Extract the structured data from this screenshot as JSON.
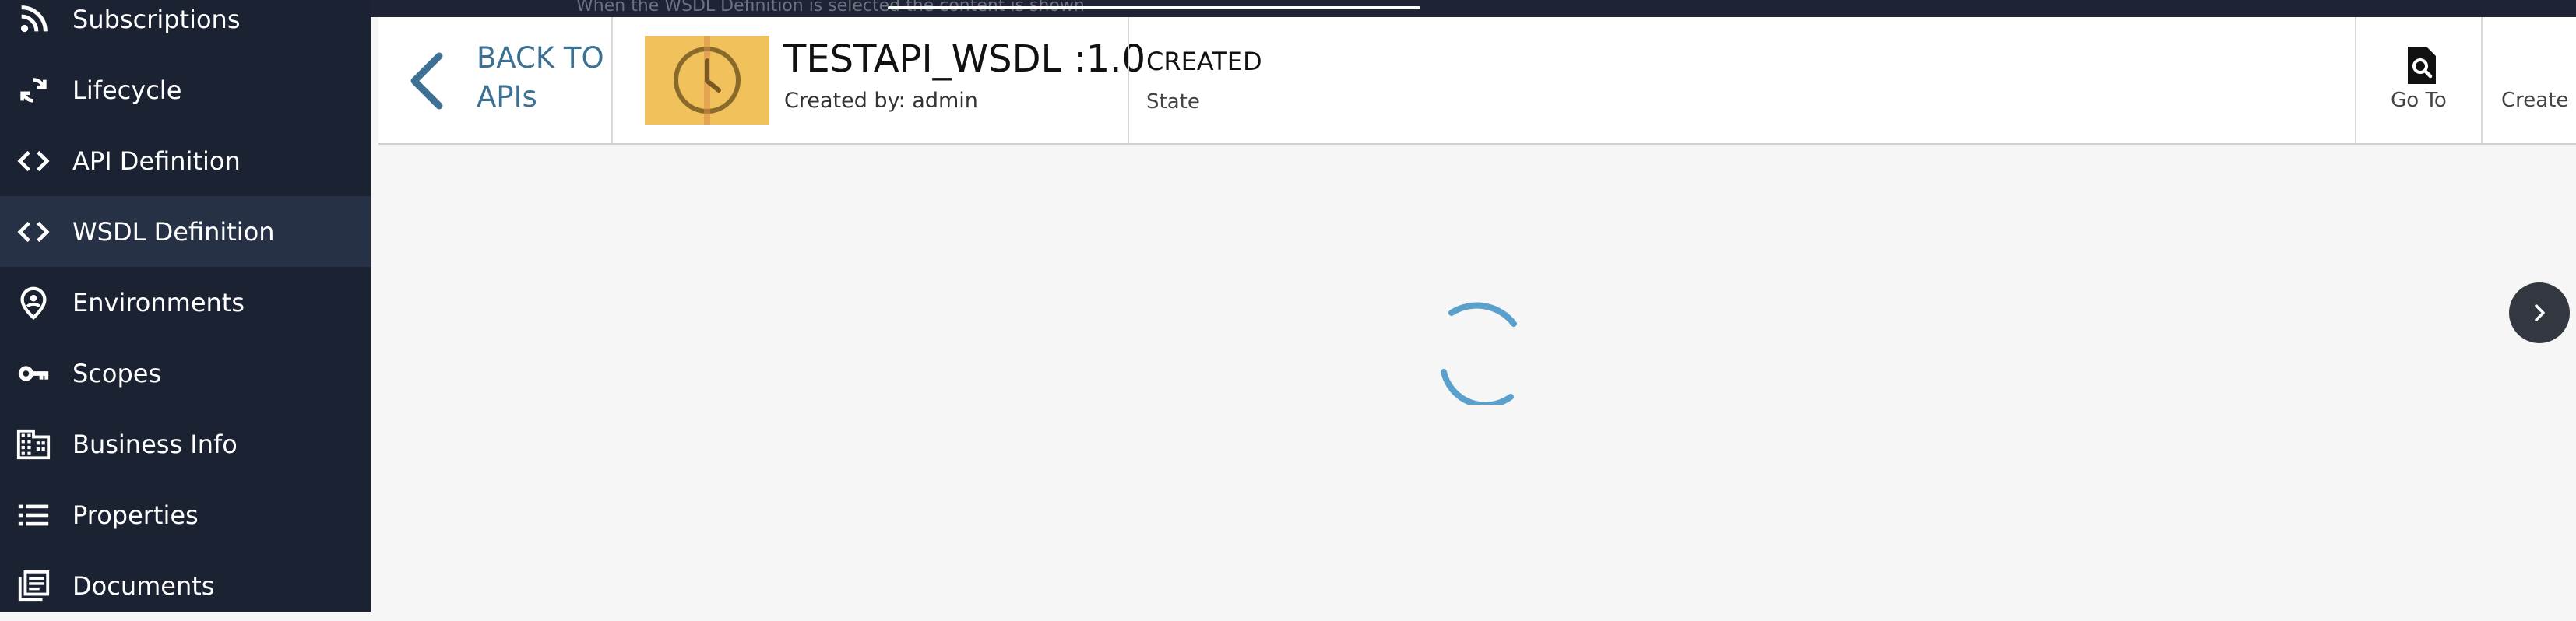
{
  "top_overlay": {
    "ghost_text": "When the WSDL Definition is selected the content is shown"
  },
  "sidebar": {
    "items": [
      {
        "label": "Subscriptions",
        "icon": "rss-icon",
        "active": false
      },
      {
        "label": "Lifecycle",
        "icon": "refresh-icon",
        "active": false
      },
      {
        "label": "API Definition",
        "icon": "code-icon",
        "active": false
      },
      {
        "label": "WSDL Definition",
        "icon": "code-icon",
        "active": true
      },
      {
        "label": "Environments",
        "icon": "location-icon",
        "active": false
      },
      {
        "label": "Scopes",
        "icon": "key-icon",
        "active": false
      },
      {
        "label": "Business Info",
        "icon": "business-icon",
        "active": false
      },
      {
        "label": "Properties",
        "icon": "list-icon",
        "active": false
      },
      {
        "label": "Documents",
        "icon": "documents-icon",
        "active": false
      }
    ]
  },
  "header": {
    "back_label": "BACK TO APIs",
    "api_title": "TESTAPI_WSDL :1.0",
    "created_by": "Created by: admin",
    "state_value": "CREATED",
    "state_label": "State",
    "goto_label": "Go To",
    "create_label": "Create N"
  },
  "colors": {
    "sidebar_bg": "#1b2232",
    "sidebar_active": "#273145",
    "accent_blue": "#3c7193",
    "spinner": "#5aa0cc",
    "thumbnail": "#f1c25c"
  }
}
